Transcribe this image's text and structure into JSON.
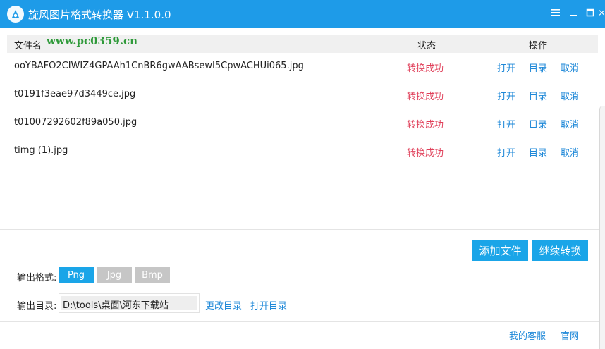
{
  "window": {
    "title": "旋风图片格式转换器 V1.1.0.0",
    "controls": {
      "menu": "≡",
      "minimize": "—",
      "maximize": "☐",
      "close": "✕"
    }
  },
  "watermark": {
    "text": "www.pc0359.cn"
  },
  "list": {
    "headers": {
      "file": "文件名",
      "status": "状态",
      "action": "操作"
    },
    "rows": [
      {
        "name": "ooYBAFO2CIWIZ4GPAAh1CnBR6gwAABsewI5CpwACHUi065.jpg",
        "status": "转换成功",
        "open": "打开",
        "dir": "目录",
        "cancel": "取消"
      },
      {
        "name": "t0191f3eae97d3449ce.jpg",
        "status": "转换成功",
        "open": "打开",
        "dir": "目录",
        "cancel": "取消"
      },
      {
        "name": "t01007292602f89a050.jpg",
        "status": "转换成功",
        "open": "打开",
        "dir": "目录",
        "cancel": "取消"
      },
      {
        "name": "timg (1).jpg",
        "status": "转换成功",
        "open": "打开",
        "dir": "目录",
        "cancel": "取消"
      }
    ]
  },
  "actions": {
    "add_file": "添加文件",
    "continue_convert": "继续转换"
  },
  "output": {
    "format_label": "输出格式:",
    "formats": [
      "Png",
      "Jpg",
      "Bmp"
    ],
    "selected_format": "Png",
    "dir_label": "输出目录:",
    "dir_value": "D:\\tools\\桌面\\河东下载站",
    "change_dir": "更改目录",
    "open_dir": "打开目录"
  },
  "footer": {
    "service": "我的客服",
    "website": "官网"
  },
  "colors": {
    "accent": "#1aa5e8",
    "titlebar": "#1e9be8",
    "success": "#e0405a",
    "link": "#1e88d8",
    "inactive": "#c6c6c6"
  }
}
